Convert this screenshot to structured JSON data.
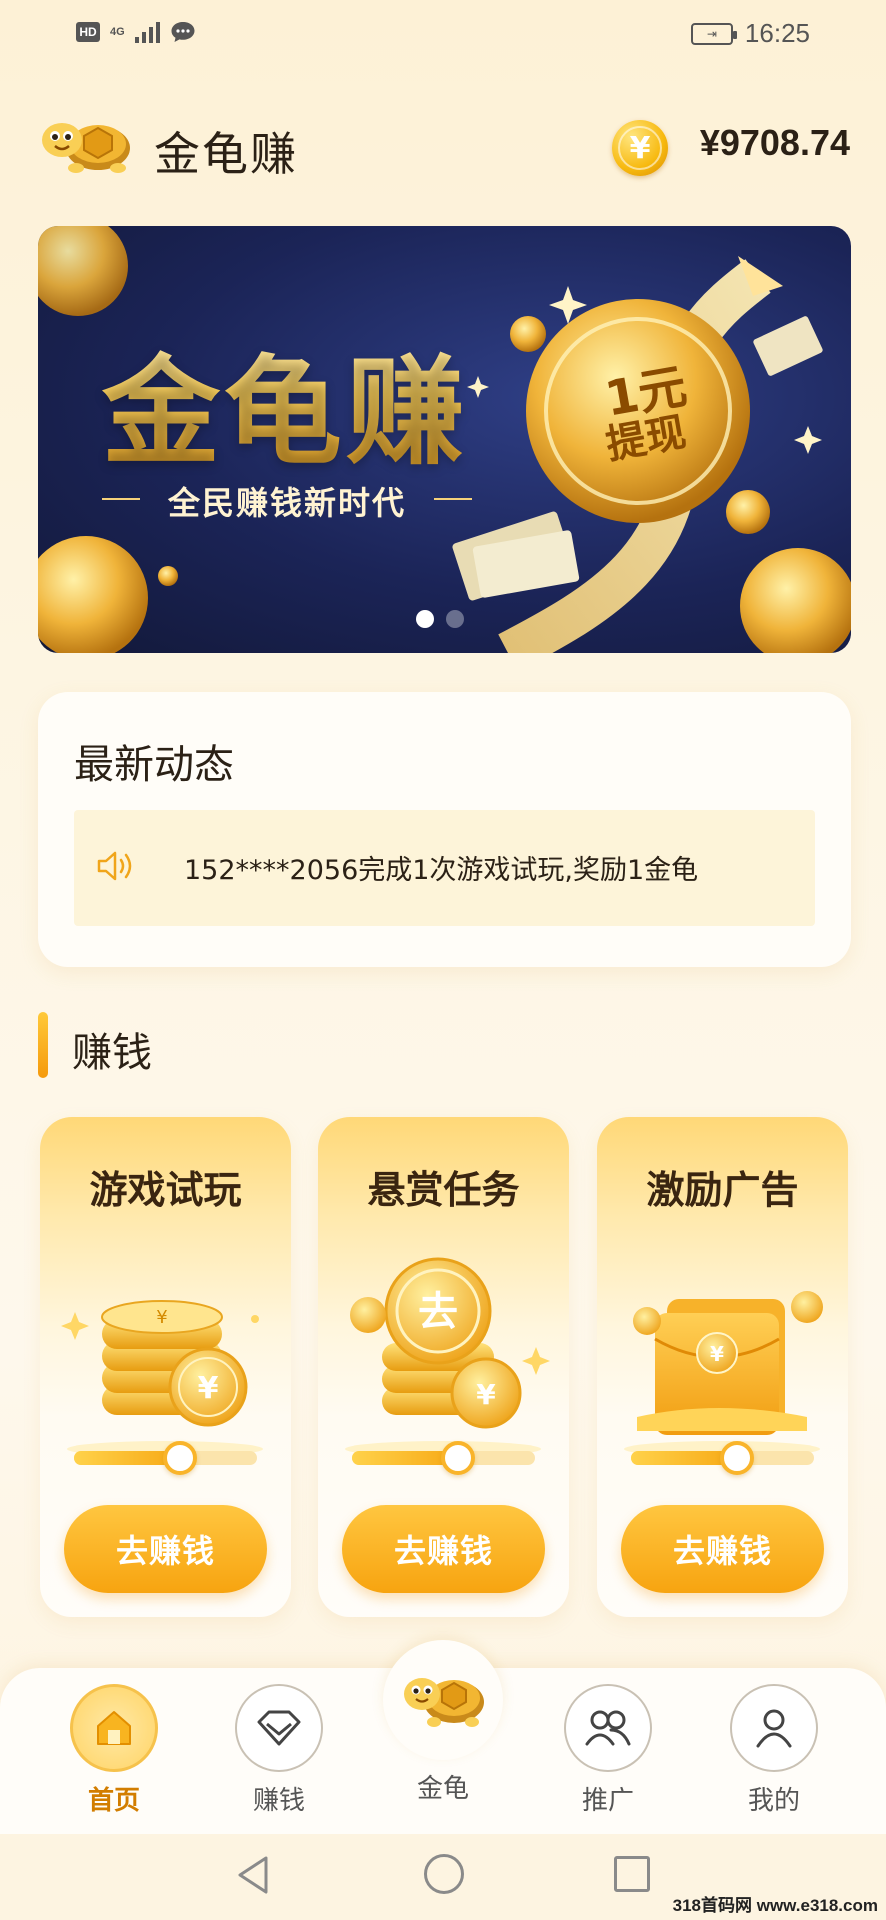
{
  "status_bar": {
    "hd": "HD",
    "network": "4G",
    "time": "16:25"
  },
  "header": {
    "app_name": "金龟赚",
    "balance": "¥9708.74",
    "coin_symbol": "¥"
  },
  "banner": {
    "title": "金龟赚",
    "subtitle": "全民赚钱新时代",
    "coin_line1": "1元",
    "coin_line2": "提现",
    "slide_count": 2,
    "active_slide": 1
  },
  "news": {
    "heading": "最新动态",
    "message": "152****2056完成1次游戏试玩,奖励1金龟"
  },
  "section": {
    "title": "赚钱"
  },
  "tasks": [
    {
      "title": "游戏试玩",
      "button": "去赚钱",
      "progress": 0.58
    },
    {
      "title": "悬赏任务",
      "button": "去赚钱",
      "progress": 0.58
    },
    {
      "title": "激励广告",
      "button": "去赚钱",
      "progress": 0.58
    }
  ],
  "task_coin_badges": {
    "task2_coin": "去"
  },
  "nav": {
    "items": [
      {
        "label": "首页",
        "icon": "home-icon",
        "active": true
      },
      {
        "label": "赚钱",
        "icon": "diamond-icon",
        "active": false
      },
      {
        "label": "金龟",
        "icon": "turtle-icon",
        "active": false
      },
      {
        "label": "推广",
        "icon": "users-icon",
        "active": false
      },
      {
        "label": "我的",
        "icon": "user-icon",
        "active": false
      }
    ]
  },
  "watermark": "318首码网 www.e318.com",
  "colors": {
    "accent": "#f7a910",
    "active_nav": "#d27d00",
    "banner_bg": "#1b2457"
  }
}
